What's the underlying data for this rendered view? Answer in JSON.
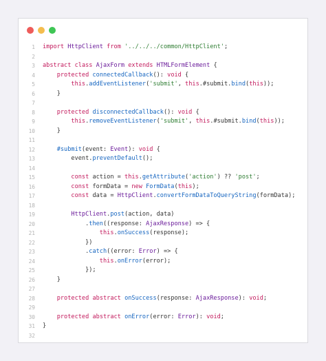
{
  "window": {
    "controls": [
      "close",
      "minimize",
      "maximize"
    ]
  },
  "code": {
    "lines": [
      "import HttpClient from '../../../common/HttpClient';",
      "",
      "abstract class AjaxForm extends HTMLFormElement {",
      "    protected connectedCallback(): void {",
      "        this.addEventListener('submit', this.#submit.bind(this));",
      "    }",
      "",
      "    protected disconnectedCallback(): void {",
      "        this.removeEventListener('submit', this.#submit.bind(this));",
      "    }",
      "",
      "    #submit(event: Event): void {",
      "        event.preventDefault();",
      "",
      "        const action = this.getAttribute('action') ?? 'post';",
      "        const formData = new FormData(this);",
      "        const data = HttpClient.convertFormDataToQueryString(formData);",
      "",
      "        HttpClient.post(action, data)",
      "            .then((response: AjaxResponse) => {",
      "                this.onSuccess(response);",
      "            })",
      "            .catch((error: Error) => {",
      "                this.onError(error);",
      "            });",
      "    }",
      "",
      "    protected abstract onSuccess(response: AjaxResponse): void;",
      "",
      "    protected abstract onError(error: Error): void;",
      "}",
      ""
    ]
  }
}
